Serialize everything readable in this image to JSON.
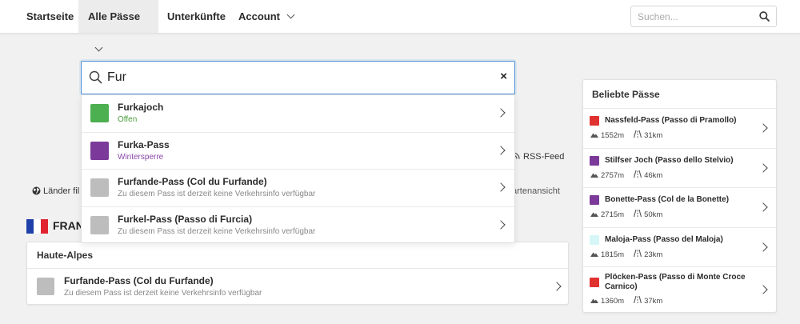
{
  "nav": {
    "items": [
      {
        "label": "Startseite"
      },
      {
        "label": "Alle Pässe"
      },
      {
        "label": "Unterkünfte"
      },
      {
        "label": "Account"
      }
    ],
    "search_placeholder": "Suchen..."
  },
  "search": {
    "value": "Fur",
    "clear_symbol": "×",
    "results": [
      {
        "name": "Furkajoch",
        "status": "Offen",
        "color": "#4caf50",
        "status_color": "#4a9d3c"
      },
      {
        "name": "Furka-Pass",
        "status": "Wintersperre",
        "color": "#7b3a99",
        "status_color": "#8a46a8"
      },
      {
        "name": "Furfande-Pass (Col du Furfande)",
        "status": "Zu diesem Pass ist derzeit keine Verkehrsinfo verfügbar",
        "color": "#bdbdbd",
        "status_color": "#888888"
      },
      {
        "name": "Furkel-Pass (Passo di Furcia)",
        "status": "Zu diesem Pass ist derzeit keine Verkehrsinfo verfügbar",
        "color": "#bdbdbd",
        "status_color": "#888888"
      }
    ]
  },
  "main": {
    "rss_label": "RSS-Feed",
    "filter_label": "Länder fil",
    "map_label": "artenansicht",
    "country_label": "FRANI",
    "region": {
      "title": "Haute-Alpes",
      "pass_name": "Furfande-Pass (Col du Furfande)",
      "pass_status": "Zu diesem Pass ist derzeit keine Verkehrsinfo verfügbar",
      "color": "#bdbdbd"
    }
  },
  "sidebar": {
    "title": "Beliebte Pässe",
    "items": [
      {
        "name": "Nassfeld-Pass (Passo di Pramollo)",
        "height": "1552m",
        "distance": "31km",
        "color": "#e03131"
      },
      {
        "name": "Stilfser Joch (Passo dello Stelvio)",
        "height": "2757m",
        "distance": "46km",
        "color": "#7b3a99"
      },
      {
        "name": "Bonette-Pass (Col de la Bonette)",
        "height": "2715m",
        "distance": "50km",
        "color": "#7b3a99"
      },
      {
        "name": "Maloja-Pass (Passo del Maloja)",
        "height": "1815m",
        "distance": "23km",
        "color": "#d6f7f7"
      },
      {
        "name": "Plöcken-Pass (Passo di Monte Croce Carnico)",
        "height": "1360m",
        "distance": "37km",
        "color": "#e03131"
      }
    ]
  }
}
